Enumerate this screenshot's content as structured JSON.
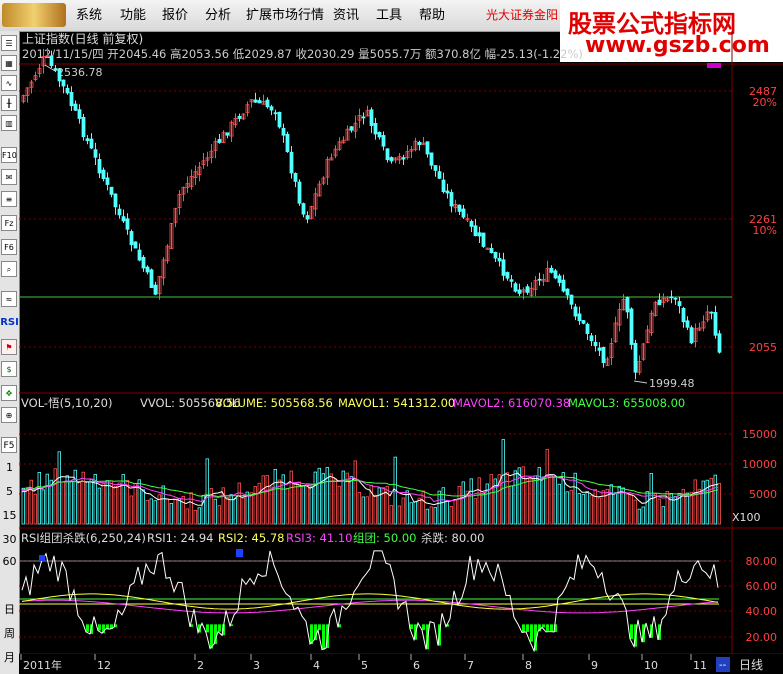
{
  "menu": {
    "items": [
      "系统",
      "功能",
      "报价",
      "分析",
      "扩展市场行情",
      "资讯",
      "工具",
      "帮助"
    ],
    "broker": "光大证券金阳"
  },
  "watermark": {
    "line1": "股票公式指标网",
    "line2": "www.gszb.com"
  },
  "sidebar": {
    "icons": [
      "list-icon",
      "grid-icon",
      "line-chart-icon",
      "candle-icon",
      "kline-icon",
      "f10-icon",
      "news-icon",
      "doc-icon",
      "fiz-icon",
      "f6-icon",
      "search-icon",
      "wave-icon",
      "rsi-icon",
      "flag-icon",
      "dollar-icon",
      "nav-icon",
      "zoom-icon"
    ],
    "labels": {
      "rsi": "RSI",
      "f5": "F5"
    },
    "nums": [
      "1",
      "5",
      "15",
      "30",
      "60"
    ],
    "periods": [
      "日",
      "周",
      "月"
    ]
  },
  "price_panel": {
    "title": "上证指数(日线 前复权)",
    "quote": "2012/11/15/四 开2045.46 高2053.56 低2029.87 收2030.29 量5055.7万 额370.8亿 幅-25.13(-1.22%)",
    "high_label": "2536.78",
    "low_label": "1999.48",
    "axis": [
      {
        "v": "2487",
        "p": "20%"
      },
      {
        "v": "2261",
        "p": "10%"
      },
      {
        "v": "2055",
        "p": ""
      }
    ]
  },
  "volume_panel": {
    "label": "VOL-悟(5,10,20)",
    "vvol": "VVOL: 505568.56",
    "volume": "VOLUME: 505568.56",
    "mavol1": "MAVOL1: 541312.00",
    "mavol2": "MAVOL2: 616070.38",
    "mavol3": "MAVOL3: 655008.00",
    "axis": [
      "15000",
      "10000",
      "5000"
    ],
    "unit": "X100"
  },
  "rsi_panel": {
    "label": "RSI组团杀跌(6,250,24)",
    "rsi1": "RSI1: 24.94",
    "rsi2": "RSI2: 45.78",
    "rsi3": "RSI3: 41.10",
    "group": "组团: 50.00",
    "kill": "杀跌: 80.00",
    "axis": [
      "80.00",
      "60.00",
      "40.00",
      "20.00"
    ]
  },
  "timeline": {
    "labels": [
      "2011年",
      "12",
      "2",
      "3",
      "4",
      "5",
      "6",
      "7",
      "8",
      "9",
      "10",
      "11"
    ],
    "mode": "日线",
    "nav": "--"
  },
  "colors": {
    "up": "#ff5050",
    "down": "#54ffff",
    "ma1": "#ffffff",
    "ma2": "#ff40ff",
    "ma3": "#40ff40",
    "rsi_yellow": "#ffff40",
    "green_bar": "#00ff00",
    "grid": "#800000"
  }
}
